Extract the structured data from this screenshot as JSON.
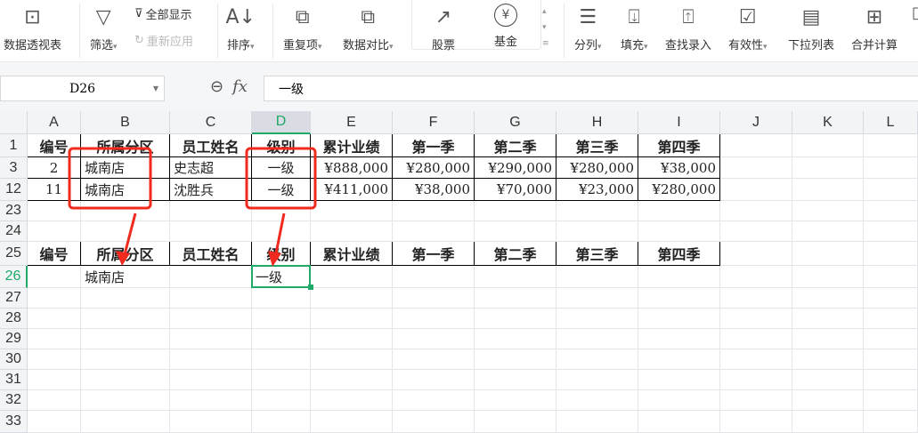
{
  "ribbon": {
    "pivot": "数据透视表",
    "filter": "筛选",
    "show_all": "全部显示",
    "reapply": "重新应用",
    "sort": "排序",
    "duplicates": "重复项",
    "compare": "数据对比",
    "stocks": "股票",
    "funds": "基金",
    "split": "分列",
    "fill": "填充",
    "lookup": "查找录入",
    "validation": "有效性",
    "dropdown": "下拉列表",
    "consolidate": "合并计算"
  },
  "formula_bar": {
    "name_box": "D26",
    "fx": "fx",
    "value": "一级"
  },
  "columns": [
    "A",
    "B",
    "C",
    "D",
    "E",
    "F",
    "G",
    "H",
    "I",
    "J",
    "K",
    "L"
  ],
  "selected_column": "D",
  "rows": [
    "1",
    "3",
    "12",
    "23",
    "24",
    "25",
    "26",
    "27",
    "28",
    "29",
    "30",
    "31",
    "32",
    "33"
  ],
  "selected_row": "26",
  "cells": {
    "r1": [
      "编号",
      "所属分区",
      "员工姓名",
      "级别",
      "累计业绩",
      "第一季",
      "第二季",
      "第三季",
      "第四季"
    ],
    "r3": [
      "2",
      "城南店",
      "史志超",
      "一级",
      "¥888,000",
      "¥280,000",
      "¥290,000",
      "¥280,000",
      "¥38,000"
    ],
    "r12": [
      "11",
      "城南店",
      "沈胜兵",
      "一级",
      "¥411,000",
      "¥38,000",
      "¥70,000",
      "¥23,000",
      "¥280,000"
    ],
    "r25": [
      "编号",
      "所属分区",
      "员工姓名",
      "级别",
      "累计业绩",
      "第一季",
      "第二季",
      "第三季",
      "第四季"
    ],
    "r26": [
      "",
      "城南店",
      "",
      "一级",
      "",
      "",
      "",
      "",
      ""
    ]
  },
  "annotation_color": "#f02a1e",
  "selection_color": "#1faa6a"
}
